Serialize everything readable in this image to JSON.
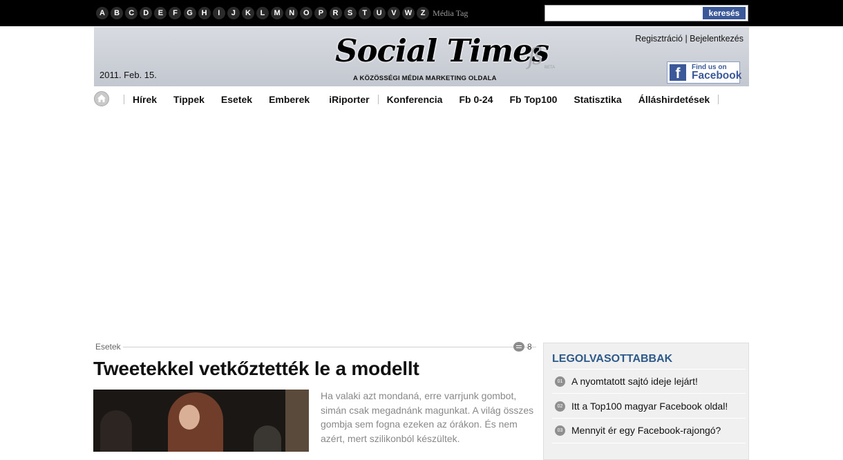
{
  "topbar": {
    "letters": [
      "A",
      "B",
      "C",
      "D",
      "E",
      "F",
      "G",
      "H",
      "I",
      "J",
      "K",
      "L",
      "M",
      "N",
      "O",
      "P",
      "R",
      "S",
      "T",
      "U",
      "V",
      "W",
      "Z"
    ],
    "media_tag": "Média Tag",
    "search_placeholder": "",
    "search_button": "keresés"
  },
  "header": {
    "register": "Regisztráció",
    "login": "Bejelentkezés",
    "logo": "Social Times",
    "tagline": "A KÖZÖSSÉGI MÉDIA MARKETING OLDALA",
    "beta_glyph": "ß",
    "beta_text": "BETA",
    "date": "2011. Feb. 15.",
    "facebook_line1": "Find us on",
    "facebook_line2": "Facebook"
  },
  "nav": {
    "items": [
      "Hírek",
      "Tippek",
      "Esetek",
      "Emberek",
      "iRiporter",
      "Konferencia",
      "Fb 0-24",
      "Fb Top100",
      "Statisztika",
      "Álláshirdetések"
    ]
  },
  "article": {
    "category": "Esetek",
    "comment_count": "8",
    "title": "Tweetekkel vetkőztették le a modellt",
    "lead": "Ha valaki azt mondaná, erre varrjunk gombot, simán csak megadnánk magunkat. A világ összes gombja sem fogna ezeken az órákon. És nem azért, mert szilikonból készültek."
  },
  "sidebar": {
    "title": "LEGOLVASOTTABBAK",
    "items": [
      {
        "num": "01",
        "text": "A nyomtatott sajtó ideje lejárt!"
      },
      {
        "num": "02",
        "text": "Itt a Top100 magyar Facebook oldal!"
      },
      {
        "num": "03",
        "text": "Mennyit ér egy Facebook-rajongó?"
      }
    ]
  },
  "colors": {
    "topbar": "#000000",
    "facebook_blue": "#3b5998",
    "sidebar_title": "#2e5a8a"
  }
}
